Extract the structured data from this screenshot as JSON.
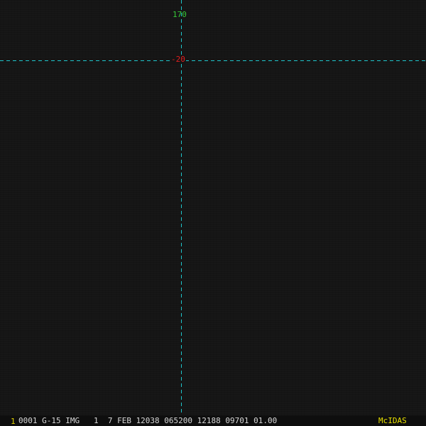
{
  "colors": {
    "background": "#141414",
    "grid_line": "#1fc6cc",
    "lon_label": "#37c837",
    "lat_label": "#e02020",
    "status_text": "#d8d8d8",
    "frame_number": "#e0d000",
    "brand": "#e8e000"
  },
  "grid": {
    "longitude_label": "170",
    "latitude_label": "-20"
  },
  "status_bar": {
    "frame_number": "1",
    "frame_info": "0001 G-15 IMG   1  7 FEB 12038 065200 12188 09701 01.00",
    "brand": "McIDAS"
  }
}
